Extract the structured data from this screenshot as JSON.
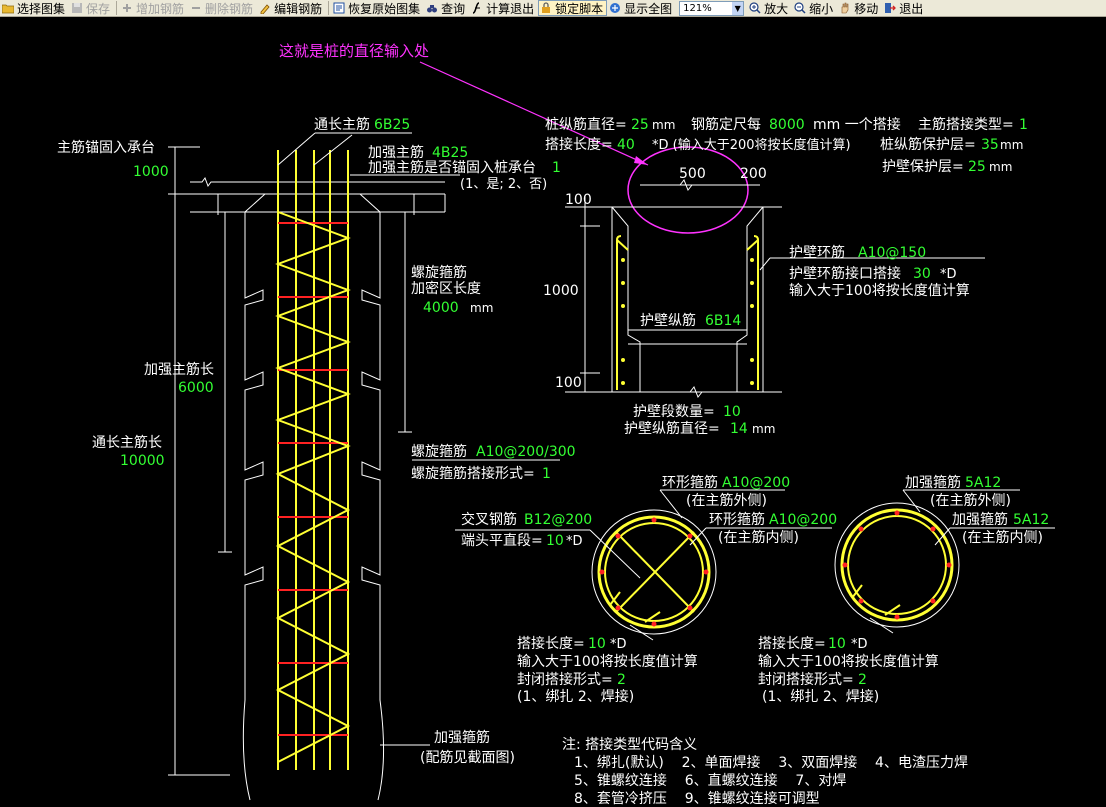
{
  "toolbar": {
    "items": [
      {
        "label": "选择图集",
        "icon": "folder-icon",
        "enabled": true
      },
      {
        "label": "保存",
        "icon": "save-icon",
        "enabled": false
      },
      {
        "label": "增加钢筋",
        "icon": "add-rebar-icon",
        "enabled": false
      },
      {
        "label": "删除钢筋",
        "icon": "delete-rebar-icon",
        "enabled": false
      },
      {
        "label": "编辑钢筋",
        "icon": "edit-rebar-icon",
        "enabled": true
      },
      {
        "label": "恢复原始图集",
        "icon": "restore-icon",
        "enabled": true
      },
      {
        "label": "查询",
        "icon": "binoculars-icon",
        "enabled": true
      },
      {
        "label": "计算退出",
        "icon": "calculate-icon",
        "enabled": true
      },
      {
        "label": "锁定脚本",
        "icon": "lock-icon",
        "enabled": true
      },
      {
        "label": "显示全图",
        "icon": "zoom-extents-icon",
        "enabled": true
      }
    ],
    "zoom_value": "121%",
    "items2": [
      {
        "label": "放大",
        "icon": "zoom-in-icon"
      },
      {
        "label": "缩小",
        "icon": "zoom-out-icon"
      },
      {
        "label": "移动",
        "icon": "pan-hand-icon"
      },
      {
        "label": "退出",
        "icon": "exit-icon"
      }
    ]
  },
  "drawing": {
    "annotation": "这就是桩的直径输入处",
    "left": {
      "main_anchor_label": "主筋锚固入承台",
      "main_anchor_value": "1000",
      "through_bar_label": "通长主筋",
      "through_bar_value": "6B25",
      "reinforce_bar_label": "加强主筋",
      "reinforce_bar_value": "4B25",
      "reinforce_anchor_q": "加强主筋是否锚固入桩承台",
      "reinforce_anchor_value": "1",
      "reinforce_anchor_opts": "(1、是; 2、否)",
      "spiral_dense_label1": "螺旋箍筋",
      "spiral_dense_label2": "加密区长度",
      "spiral_dense_value": "4000",
      "spiral_dense_unit": "mm",
      "reinforce_len_label": "加强主筋长",
      "reinforce_len_value": "6000",
      "through_len_label": "通长主筋长",
      "through_len_value": "10000",
      "spiral_label": "螺旋箍筋",
      "spiral_value": "A10@200/300",
      "spiral_lap_label": "螺旋箍筋搭接形式=",
      "spiral_lap_value": "1",
      "stirrup_label": "加强箍筋",
      "stirrup_note": "(配筋见截面图)"
    },
    "top": {
      "bar_dia_label": "桩纵筋直径=",
      "bar_dia_value": "25",
      "bar_dia_unit": "mm",
      "fixed_len_label": "钢筋定尺每",
      "fixed_len_value": "8000",
      "fixed_len_unit": "mm 一个搭接",
      "lap_type_label": "主筋搭接类型=",
      "lap_type_value": "1",
      "lap_len_label": "搭接长度=",
      "lap_len_value": "40",
      "lap_len_note": "*D (输入大于200将按长度值计算)",
      "cover_label": "桩纵筋保护层=",
      "cover_value": "35",
      "cover_unit": "mm",
      "wall_cover_label": "护壁保护层=",
      "wall_cover_value": "25",
      "wall_cover_unit": "mm"
    },
    "wall": {
      "dim_500": "500",
      "dim_200": "200",
      "dim_100_top": "100",
      "dim_1000": "1000",
      "dim_100_bottom": "100",
      "ring_label": "护壁环筋",
      "ring_value": "A10@150",
      "ring_lap_label": "护壁环筋接口搭接",
      "ring_lap_value": "30",
      "ring_lap_unit": "*D",
      "ring_lap_note": "输入大于100将按长度值计算",
      "long_bar_label": "护壁纵筋",
      "long_bar_value": "6B14",
      "seg_count_label": "护壁段数量=",
      "seg_count_value": "10",
      "long_dia_label": "护壁纵筋直径=",
      "long_dia_value": "14",
      "long_dia_unit": "mm"
    },
    "section1": {
      "outer_label": "环形箍筋",
      "outer_value": "A10@200",
      "outer_note": "(在主筋外侧)",
      "inner_label": "环形箍筋",
      "inner_value": "A10@200",
      "inner_note": "(在主筋内侧)",
      "cross_label": "交叉钢筋",
      "cross_value": "B12@200",
      "end_label": "端头平直段=",
      "end_value": "10",
      "end_unit": "*D",
      "lap_label": "搭接长度=",
      "lap_value": "10",
      "lap_unit": "*D",
      "lap_note": "输入大于100将按长度值计算",
      "close_label": "封闭搭接形式=",
      "close_value": "2",
      "close_opts": "(1、绑扎  2、焊接)"
    },
    "section2": {
      "outer_label": "加强箍筋",
      "outer_value": "5A12",
      "outer_note": "(在主筋外侧)",
      "inner_label": "加强箍筋",
      "inner_value": "5A12",
      "inner_note": "(在主筋内侧)",
      "lap_label": "搭接长度=",
      "lap_value": "10",
      "lap_unit": "*D",
      "lap_note": "输入大于100将按长度值计算",
      "close_label": "封闭搭接形式=",
      "close_value": "2",
      "close_opts": "(1、绑扎  2、焊接)"
    },
    "notes": {
      "title": "注: 搭接类型代码含义",
      "line1": "1、绑扎(默认)    2、单面焊接    3、双面焊接    4、电渣压力焊",
      "line2": "5、锥螺纹连接    6、直螺纹连接    7、对焊",
      "line3": "8、套管冷挤压    9、锥螺纹连接可调型"
    }
  },
  "colors": {
    "background": "#000000",
    "text": "#ffffff",
    "value": "#33ff33",
    "rebar": "#ffff33",
    "stirrup": "#ff2222",
    "annotation": "#ff33ff"
  }
}
